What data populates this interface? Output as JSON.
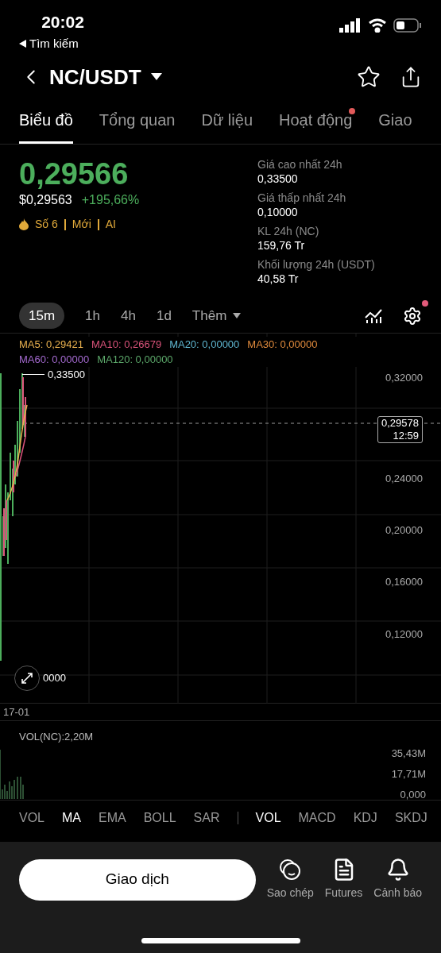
{
  "status_bar": {
    "time": "20:02",
    "back_label": "Tìm kiếm"
  },
  "header": {
    "pair": "NC/USDT"
  },
  "tabs": [
    {
      "label": "Biểu đồ",
      "selected": true,
      "dot": false
    },
    {
      "label": "Tổng quan",
      "selected": false,
      "dot": false
    },
    {
      "label": "Dữ liệu",
      "selected": false,
      "dot": false
    },
    {
      "label": "Hoạt động",
      "selected": false,
      "dot": true
    },
    {
      "label": "Giao",
      "selected": false,
      "dot": false
    }
  ],
  "price": {
    "last": "0,29566",
    "usd": "$0,29563",
    "change": "+195,66%",
    "tags": [
      "Số 6",
      "Mới",
      "AI"
    ]
  },
  "stats": [
    {
      "label": "Giá cao nhất 24h",
      "value": "0,33500"
    },
    {
      "label": "Giá thấp nhất 24h",
      "value": "0,10000"
    },
    {
      "label": "KL 24h (NC)",
      "value": "159,76 Tr"
    },
    {
      "label": "Khối lượng 24h (USDT)",
      "value": "40,58 Tr"
    }
  ],
  "timeframes": [
    {
      "label": "15m",
      "selected": true
    },
    {
      "label": "1h",
      "selected": false
    },
    {
      "label": "4h",
      "selected": false
    },
    {
      "label": "1d",
      "selected": false
    }
  ],
  "more_label": "Thêm",
  "settings_dot": true,
  "ma_legend": [
    {
      "text": "MA5: 0,29421",
      "color": "#e8b04e"
    },
    {
      "text": "MA10: 0,26679",
      "color": "#d9537a"
    },
    {
      "text": "MA20: 0,00000",
      "color": "#5fb6d0"
    },
    {
      "text": "MA30: 0,00000",
      "color": "#e08a3c"
    },
    {
      "text": "MA60: 0,00000",
      "color": "#a46ad0"
    },
    {
      "text": "MA120: 0,00000",
      "color": "#5ca86a"
    }
  ],
  "chart": {
    "high_label": "0,33500",
    "low_label": "0000",
    "y_labels": [
      "0,32000",
      "0,24000",
      "0,20000",
      "0,16000",
      "0,12000"
    ],
    "last_price": "0,29578",
    "countdown": "12:59",
    "date": "17-01"
  },
  "volume": {
    "label": "VOL(NC):2,20M",
    "y_labels": [
      "35,43M",
      "17,71M",
      "0,000"
    ]
  },
  "main_indicators": [
    {
      "label": "VOL",
      "selected": false
    },
    {
      "label": "MA",
      "selected": true
    },
    {
      "label": "EMA",
      "selected": false
    },
    {
      "label": "BOLL",
      "selected": false
    },
    {
      "label": "SAR",
      "selected": false
    }
  ],
  "sub_indicators": [
    {
      "label": "VOL",
      "selected": true
    },
    {
      "label": "MACD",
      "selected": false
    },
    {
      "label": "KDJ",
      "selected": false
    },
    {
      "label": "SKDJ",
      "selected": false
    }
  ],
  "bottom": {
    "trade_button": "Giao dịch",
    "actions": [
      {
        "kind": "copy",
        "label": "Sao chép"
      },
      {
        "kind": "futures",
        "label": "Futures"
      },
      {
        "kind": "alert",
        "label": "Cảnh báo"
      }
    ]
  }
}
